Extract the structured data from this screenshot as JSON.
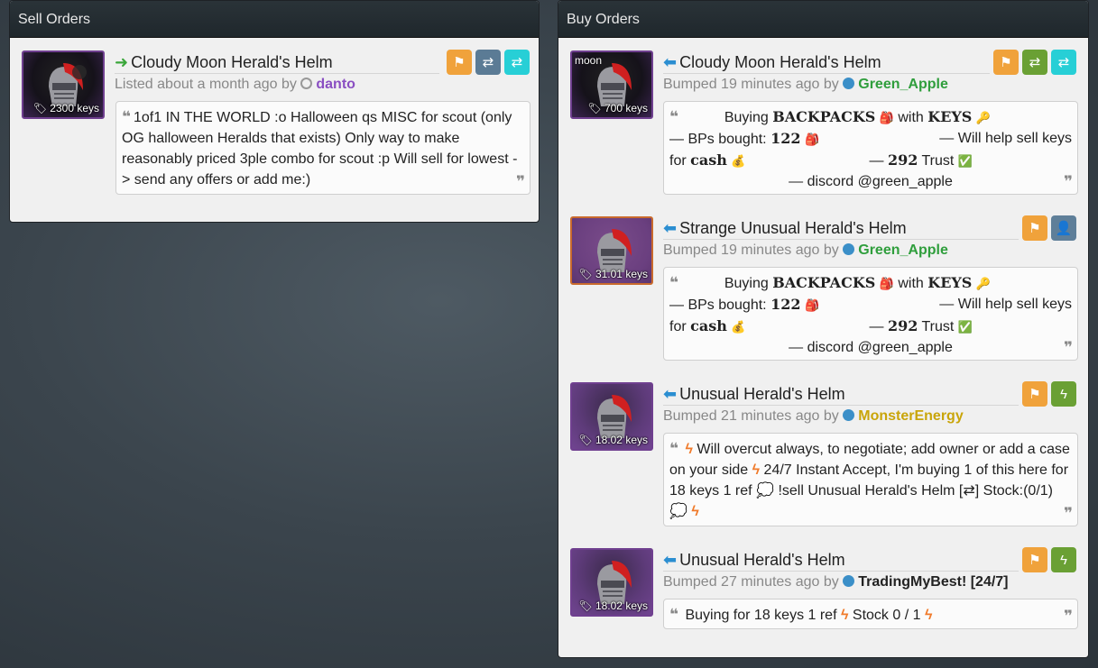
{
  "sell": {
    "title": "Sell Orders",
    "listing": {
      "name": "Cloudy Moon Herald's Helm",
      "price": "2300 keys",
      "meta_prefix": "Listed about a month ago by",
      "user": "danto",
      "user_color": "#8a4fc2",
      "desc": "1of1 IN THE WORLD :o Halloween qs MISC for scout (only OG halloween Heralds that exists) Only way to make reasonably priced 3ple combo for scout :p Will sell for lowest -> send any offers or add me:)"
    }
  },
  "buy": {
    "title": "Buy Orders",
    "listings": [
      {
        "name": "Cloudy Moon Herald's Helm",
        "price": "700 keys",
        "thumb_label": "moon",
        "meta_prefix": "Bumped 19 minutes ago by",
        "user": "Green_Apple",
        "user_color": "#2f9e3c",
        "q_buying": "Buying",
        "q_backpacks": "BACKPACKS",
        "q_with": "with",
        "q_keys": "KEYS",
        "q_bps": "— BPs bought:",
        "q_bps_num": "122",
        "q_help": "— Will help sell keys",
        "q_for": "for",
        "q_cash": "cash",
        "q_trust_dash": "—",
        "q_trust_num": "292",
        "q_trust": "Trust",
        "q_discord": "— discord @green_apple"
      },
      {
        "name": "Strange Unusual Herald's Helm",
        "price": "31.01 keys",
        "meta_prefix": "Bumped 19 minutes ago by",
        "user": "Green_Apple",
        "user_color": "#2f9e3c",
        "q_buying": "Buying",
        "q_backpacks": "BACKPACKS",
        "q_with": "with",
        "q_keys": "KEYS",
        "q_bps": "— BPs bought:",
        "q_bps_num": "122",
        "q_help": "— Will help sell keys",
        "q_for": "for",
        "q_cash": "cash",
        "q_trust_dash": "—",
        "q_trust_num": "292",
        "q_trust": "Trust",
        "q_discord": "— discord @green_apple"
      },
      {
        "name": "Unusual Herald's Helm",
        "price": "18.02 keys",
        "meta_prefix": "Bumped 21 minutes ago by",
        "user": "MonsterEnergy",
        "user_color": "#c9a50a",
        "desc_a": "Will overcut always, to negotiate; add owner or add a case on your side",
        "desc_b": "24/7 Instant Accept, I'm buying 1 of this here for 18 keys 1 ref",
        "desc_c": "!sell Unusual Herald's Helm [⇄] Stock:(0/1)"
      },
      {
        "name": "Unusual Herald's Helm",
        "price": "18.02 keys",
        "meta_prefix": "Bumped 27 minutes ago by",
        "user": "TradingMyBest! [24/7]",
        "user_color": "#222222",
        "desc_a": "Buying for 18 keys 1 ref",
        "desc_b": "Stock 0 / 1"
      }
    ]
  }
}
